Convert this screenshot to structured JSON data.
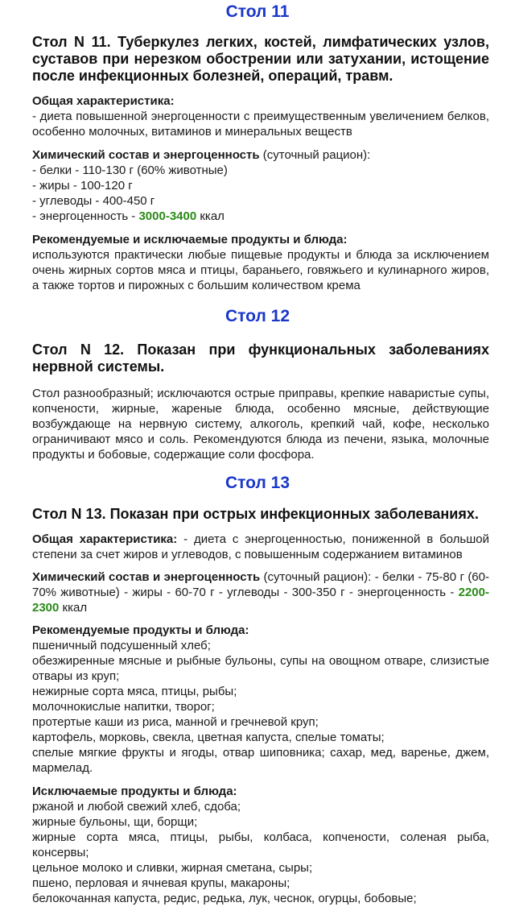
{
  "s11": {
    "title": "Стол 11",
    "heading": "Стол N 11. Туберкулез легких, костей, лимфатических узлов, суставов при нерезком обострении или затухании, истощение после инфекционных болезней, операций, травм.",
    "general_label": "Общая характеристика:",
    "general_text": "- диета повышенной энергоценности с преимущественным увеличением белков, особенно молочных, витаминов и минеральных веществ",
    "chem_label": "Химический состав и энергоценность",
    "chem_note": " (суточный рацион):",
    "chem_items": [
      "- белки - 110-130 г (60% животные)",
      "- жиры - 100-120 г",
      "- углеводы - 400-450 г"
    ],
    "energy_prefix": "- энергоценность - ",
    "energy_value": "3000-3400",
    "energy_unit": " ккал",
    "products_label": "Рекомендуемые и исключаемые продукты и блюда:",
    "products_text": "используются практически любые пищевые продукты и блюда за исключением очень жирных сортов мяса и птицы, бараньего, говяжьего и кулинарного жиров, а также тортов и пирожных с большим количеством крема"
  },
  "s12": {
    "title": "Стол 12",
    "heading": "Стол N 12. Показан при функциональных заболеваниях нервной системы.",
    "text": "Стол разнообразный; исключаются острые приправы, крепкие наваристые супы, копчености, жирные, жареные блюда, особенно мясные, действующие возбуждающе на нервную систему, алкоголь, крепкий чай, кофе, несколько ограничивают мясо и соль. Рекомендуются блюда из печени, языка, молочные продукты и бобовые, содержащие соли фосфора."
  },
  "s13": {
    "title": "Стол 13",
    "heading": "Стол N 13. Показан при острых инфекционных заболеваниях.",
    "general_label": "Общая характеристика:",
    "general_text": " - диета с энергоценностью, пониженной в большой степени за счет жиров и углеводов, с повышенным содержанием витаминов",
    "chem_label": "Химический состав и энергоценность",
    "chem_text": " (суточный рацион): - белки - 75-80 г (60-70% животные) - жиры - 60-70 г - углеводы - 300-350 г - энергоценность - ",
    "energy_value": "2200-2300",
    "energy_unit": " ккал",
    "rec_label": "Рекомендуемые продукты и блюда:",
    "rec_items": [
      "пшеничный подсушенный хлеб;",
      "обезжиренные мясные и рыбные бульоны, супы на овощном отваре, слизистые отвары из круп;",
      "нежирные сорта мяса, птицы, рыбы;",
      "молочнокислые напитки, творог;",
      "протертые каши из риса, манной и гречневой круп;",
      "картофель, морковь, свекла, цветная капуста, спелые томаты;",
      "спелые мягкие фрукты и ягоды, отвар шиповника; сахар, мед, варенье, джем, мармелад."
    ],
    "exc_label": "Исключаемые продукты и блюда:",
    "exc_items": [
      "ржаной и любой свежий хлеб, сдоба;",
      "жирные бульоны, щи, борщи;",
      "жирные сорта мяса, птицы, рыбы, колбаса, копчености, соленая рыба, консервы;",
      "цельное молоко и сливки, жирная сметана, сыры;",
      "пшено, перловая и ячневая крупы, макароны;",
      "белокочанная капуста, редис, редька, лук, чеснок, огурцы, бобовые;"
    ]
  }
}
